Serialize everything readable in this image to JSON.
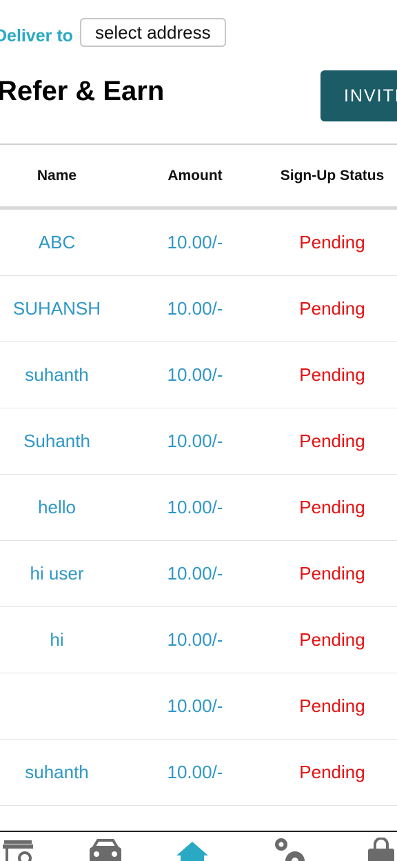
{
  "header": {
    "deliver_label": "Deliver to",
    "address_button": "select address",
    "title": "Refer & Earn",
    "invite_button": "INVITE"
  },
  "table": {
    "columns": [
      "Name",
      "Amount",
      "Sign-Up Status"
    ],
    "rows": [
      {
        "name": "ABC",
        "amount": "10.00/-",
        "status": "Pending"
      },
      {
        "name": "SUHANSH",
        "amount": "10.00/-",
        "status": "Pending"
      },
      {
        "name": "suhanth",
        "amount": "10.00/-",
        "status": "Pending"
      },
      {
        "name": "Suhanth",
        "amount": "10.00/-",
        "status": "Pending"
      },
      {
        "name": "hello",
        "amount": "10.00/-",
        "status": "Pending"
      },
      {
        "name": "hi user",
        "amount": "10.00/-",
        "status": "Pending"
      },
      {
        "name": "hi",
        "amount": "10.00/-",
        "status": "Pending"
      },
      {
        "name": "",
        "amount": "10.00/-",
        "status": "Pending"
      },
      {
        "name": "suhanth",
        "amount": "10.00/-",
        "status": "Pending"
      }
    ]
  },
  "bottom_nav": {
    "items": [
      {
        "icon": "store-icon"
      },
      {
        "icon": "car-icon"
      },
      {
        "icon": "home-icon",
        "active": true
      },
      {
        "icon": "settings-icon"
      },
      {
        "icon": "shopping-bag-icon"
      }
    ]
  },
  "colors": {
    "accent": "#29a9c4",
    "invite_bg": "#1b5c66",
    "link_blue": "#2f97c6",
    "pending_red": "#e51212",
    "nav_gray": "#6b6b6b"
  }
}
